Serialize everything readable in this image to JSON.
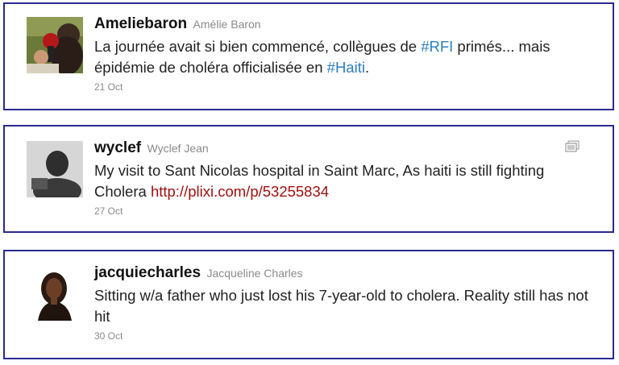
{
  "tweets": [
    {
      "screen_name": "Ameliebaron",
      "full_name": "Amélie Baron",
      "text_parts": {
        "p1": "La journée avait si bien commencé, collègues de ",
        "tag1": "#RFI",
        "p2": " primés... mais épidémie de choléra officialisée en ",
        "tag2": "#Haiti",
        "p3": "."
      },
      "timestamp": "21 Oct"
    },
    {
      "screen_name": "wyclef",
      "full_name": "Wyclef Jean",
      "text_parts": {
        "p1": "My visit to Sant Nicolas hospital in Saint Marc, As haiti is still fighting Cholera ",
        "link": "http://plixi.com/p/53255834"
      },
      "timestamp": "27 Oct",
      "media_icon": "media-preview-icon"
    },
    {
      "screen_name": "jacquiecharles",
      "full_name": "Jacqueline Charles",
      "text_parts": {
        "p1": "Sitting w/a father who just lost his 7-year-old to cholera. Reality still has not hit"
      },
      "timestamp": "30 Oct"
    }
  ],
  "colors": {
    "border": "#2a2a8f",
    "hashtag": "#2d7fc1",
    "link": "#a01010",
    "meta": "#8a8a8a"
  }
}
